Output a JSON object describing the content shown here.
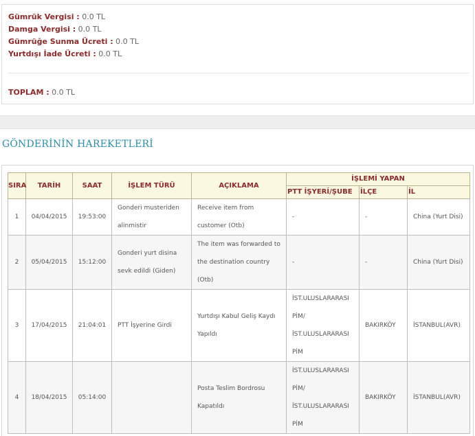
{
  "fees": {
    "items": [
      {
        "label": "Gümrük Vergisi :",
        "value": "0.0 TL"
      },
      {
        "label": "Damga Vergisi :",
        "value": "0.0 TL"
      },
      {
        "label": "Gümrüğe Sunma Ücreti :",
        "value": "0.0 TL"
      },
      {
        "label": "Yurtdışı İade Ücreti :",
        "value": "0.0 TL"
      }
    ],
    "total": {
      "label": "TOPLAM :",
      "value": "0.0 TL"
    }
  },
  "movements": {
    "title": "GÖNDERİNİN HAREKETLERİ",
    "headers": {
      "sira": "SIRA",
      "tarih": "TARİH",
      "saat": "SAAT",
      "islem_turu": "İŞLEM TÜRÜ",
      "aciklama": "AÇIKLAMA",
      "islemi_yapan": "İŞLEMİ YAPAN",
      "ptt_isyeri": "PTT İŞYERİ/ŞUBE",
      "ilce": "İLÇE",
      "il": "İL"
    },
    "rows": [
      {
        "sira": "1",
        "tarih": "04/04/2015",
        "saat": "19:53:00",
        "islem": "Gonderi musteriden alinmistir",
        "aciklama": "Receive item from customer (Otb)",
        "isyeri": "-",
        "ilce": "-",
        "il": "China (Yurt Disi)"
      },
      {
        "sira": "2",
        "tarih": "05/04/2015",
        "saat": "15:12:00",
        "islem": "Gonderi yurt disina sevk edildi (Giden)",
        "aciklama": "The item was forwarded to the destination country (Otb)",
        "isyeri": "-",
        "ilce": "-",
        "il": "China (Yurt Disi)"
      },
      {
        "sira": "3",
        "tarih": "17/04/2015",
        "saat": "21:04:01",
        "islem": "PTT İşyerine Girdi",
        "aciklama": "Yurtdışı Kabul Geliş Kaydı Yapıldı",
        "isyeri": "İST.ULUSLARARASI PİM/ İST.ULUSLARARASI PİM",
        "ilce": "BAKIRKÖY",
        "il": "İSTANBUL(AVR)"
      },
      {
        "sira": "4",
        "tarih": "18/04/2015",
        "saat": "05:14:00",
        "islem": "",
        "aciklama": "Posta Teslim Bordrosu Kapatıldı",
        "isyeri": "İST.ULUSLARARASI PİM/ İST.ULUSLARARASI PİM",
        "ilce": "BAKIRKÖY",
        "il": "İSTANBUL(AVR)"
      }
    ]
  }
}
